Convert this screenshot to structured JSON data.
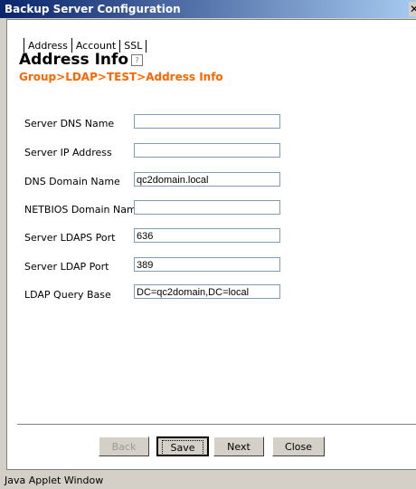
{
  "window": {
    "title": "Backup Server Configuration",
    "close_glyph": "✕"
  },
  "tabs": [
    {
      "label": "Address",
      "active": true
    },
    {
      "label": "Account",
      "active": false
    },
    {
      "label": "SSL",
      "active": false
    }
  ],
  "heading": {
    "title": "Address Info",
    "help_icon": "help-icon",
    "help_glyph": "?"
  },
  "breadcrumb": "Group>LDAP>TEST>Address Info",
  "fields": [
    {
      "label": "Server DNS Name",
      "value": ""
    },
    {
      "label": "Server IP Address",
      "value": ""
    },
    {
      "label": "DNS Domain Name",
      "value": "qc2domain.local"
    },
    {
      "label": "NETBIOS Domain Name",
      "value": ""
    },
    {
      "label": "Server LDAPS Port",
      "value": "636"
    },
    {
      "label": "Server LDAP Port",
      "value": "389"
    },
    {
      "label": "LDAP Query Base",
      "value": "DC=qc2domain,DC=local"
    }
  ],
  "buttons": {
    "back": "Back",
    "save": "Save",
    "next": "Next",
    "close": "Close"
  },
  "status_bar": "Java Applet Window",
  "colors": {
    "accent": "#ff6600",
    "titlebar": "#0a246a"
  }
}
